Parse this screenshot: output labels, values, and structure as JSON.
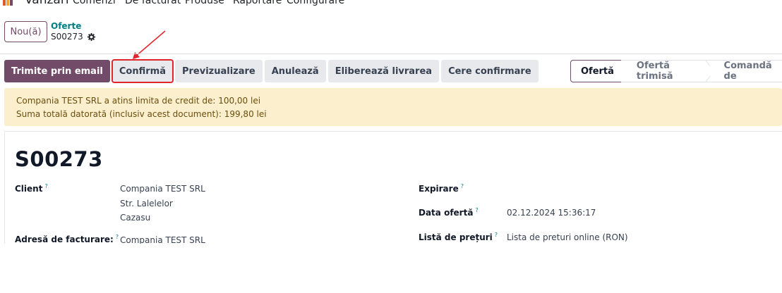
{
  "topnav": {
    "app_name": "Vânzări",
    "menu": [
      "Comenzi",
      "De facturat",
      "Produse",
      "Raportare",
      "Configurare"
    ]
  },
  "control": {
    "new_label": "Nou(ă)",
    "breadcrumb_parent": "Oferte",
    "breadcrumb_current": "S00273"
  },
  "actions": {
    "send_email": "Trimite prin email",
    "confirm": "Confirmă",
    "preview": "Previzualizare",
    "cancel": "Anulează",
    "release_delivery": "Eliberează livrarea",
    "request_confirmation": "Cere confirmare"
  },
  "status": {
    "steps": [
      "Ofertă",
      "Ofertă trimisă",
      "Comandă de"
    ],
    "active": "Ofertă"
  },
  "alert": {
    "line1": "Compania TEST SRL a atins limita de credit de: 100,00 lei",
    "line2": "Suma totală datorată (inclusiv acest document): 199,80 lei"
  },
  "form": {
    "title": "S00273",
    "client_label": "Client",
    "client_name": "Compania TEST SRL",
    "client_street": "Str. Lalelelor",
    "client_city": "Cazasu",
    "invoice_address_label": "Adresă de facturare:",
    "invoice_address_value": "Compania TEST SRL",
    "expiration_label": "Expirare",
    "quote_date_label": "Data ofertă",
    "quote_date_value": "02.12.2024 15:36:17",
    "pricelist_label": "Listă de prețuri",
    "pricelist_value": "Lista de preturi online (RON)",
    "help_mark": "?"
  },
  "colors": {
    "primary": "#714b67",
    "link": "#017e84",
    "alert_bg": "#fbefce",
    "annotation": "#e0262b"
  }
}
